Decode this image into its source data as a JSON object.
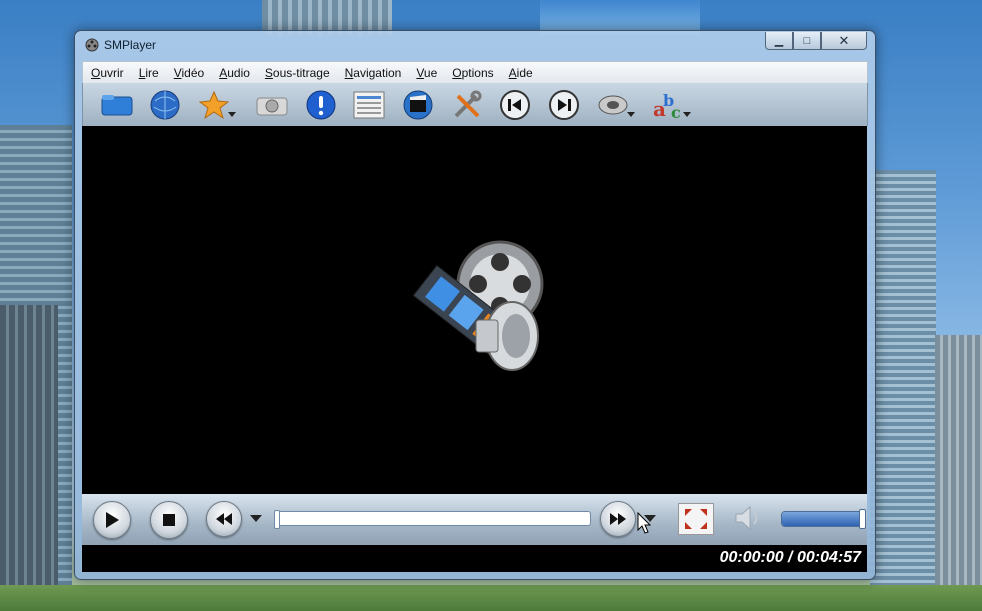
{
  "window": {
    "title": "SMPlayer",
    "controls": {
      "minimize": "▁",
      "maximize": "□",
      "close": "✕"
    }
  },
  "menubar": {
    "items": [
      {
        "underline": "O",
        "rest": "uvrir"
      },
      {
        "underline": "L",
        "rest": "ire"
      },
      {
        "underline": "V",
        "rest": "idéo"
      },
      {
        "underline": "A",
        "rest": "udio"
      },
      {
        "underline": "S",
        "rest": "ous-titrage"
      },
      {
        "underline": "N",
        "rest": "avigation"
      },
      {
        "underline": "V",
        "rest": "ue"
      },
      {
        "underline": "O",
        "rest": "ptions"
      },
      {
        "underline": "A",
        "rest": "ide"
      }
    ]
  },
  "toolbar": {
    "icons": [
      "folder-icon",
      "globe-icon",
      "favorites-star-icon",
      "screenshot-camera-icon",
      "info-icon",
      "playlist-icon",
      "video-settings-icon",
      "preferences-tools-icon",
      "previous-icon",
      "next-icon",
      "audio-track-icon",
      "subtitles-abc-icon"
    ]
  },
  "playback": {
    "current_time": "00:00:00",
    "separator": " / ",
    "total_time": "00:04:57",
    "progress": 0.0,
    "volume": 1.0
  },
  "colors": {
    "accent": "#2e63b3",
    "video_bg": "#000000"
  }
}
